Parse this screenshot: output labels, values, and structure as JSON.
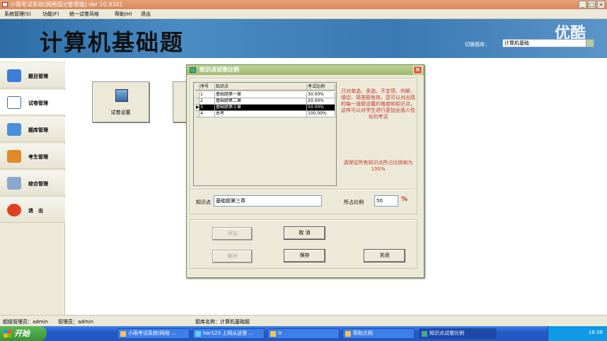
{
  "window": {
    "title": "小雨考试系统(网络版)[管理端] Ver 10.9341",
    "controls": [
      "_",
      "□",
      "×"
    ]
  },
  "menu": [
    "系统管理(S)",
    "功能(F)",
    "统一试卷风格",
    "帮助(H)",
    "退出"
  ],
  "banner": {
    "title": "计算机基础题",
    "watermark": "优酷",
    "switch_label": "切换题库：",
    "switch_value": "计算机基础"
  },
  "sidebar": {
    "items": [
      {
        "label": "题目管理",
        "icon": "book-icon",
        "color": "#3b7dd8"
      },
      {
        "label": "试卷管理",
        "icon": "document-icon",
        "color": "#ffffff",
        "active": true
      },
      {
        "label": "题库管理",
        "icon": "database-icon",
        "color": "#4a90d9"
      },
      {
        "label": "考生管理",
        "icon": "users-icon",
        "color": "#e08a2a"
      },
      {
        "label": "综合管理",
        "icon": "tools-icon",
        "color": "#8aa7cf"
      },
      {
        "label": "退　出",
        "icon": "exit-icon",
        "color": "#e0401f"
      }
    ]
  },
  "main": {
    "tiles": [
      {
        "label": "试卷设置",
        "icon": "exam-settings-icon"
      }
    ]
  },
  "dialog": {
    "title": "知识点试卷比例",
    "close": "×",
    "table": {
      "headers": [
        "序号",
        "知识点",
        "考试比例"
      ],
      "rows": [
        {
          "num": "1",
          "name": "基础题第一章",
          "ratio": "30.00%"
        },
        {
          "num": "2",
          "name": "基础题第二章",
          "ratio": "20.00%"
        },
        {
          "num": "3",
          "name": "基础题第三章",
          "ratio": "50.00%",
          "selected": true
        },
        {
          "num": "4",
          "name": "总考",
          "ratio": "100.00%"
        }
      ],
      "row_pointer": "▶"
    },
    "note1": "只对单选、多选、不定项、判断、填空、简答题有效。您可以对出现的每一道题设置的难度和知识点，这样可以对学生进行更加全面人性化的考试",
    "note2": "请保证所有知识点所占比例和为100%",
    "field_label": "知识点",
    "field_value": "基础题第三章",
    "ratio_label": "所占比例",
    "ratio_value": "50",
    "ratio_unit": "%",
    "buttons": {
      "add": "添加",
      "cancel": "取 消",
      "delete": "删除",
      "save": "保存",
      "close": "关闭"
    }
  },
  "statusbar": {
    "left": "超级管理员：admin",
    "user": "管理员：admin",
    "db": "题库名称：计算机基础题"
  },
  "taskbar": {
    "start": "开始",
    "tasks": [
      {
        "label": "小雨考试系统(网络 ...",
        "active": false
      },
      {
        "label": "har123 上网从这里 ...",
        "active": false
      },
      {
        "label": "tr",
        "active": false
      },
      {
        "label": "帮助文档",
        "active": false
      },
      {
        "label": "知识点试卷比例",
        "active": true
      }
    ],
    "clock": "18:36"
  }
}
